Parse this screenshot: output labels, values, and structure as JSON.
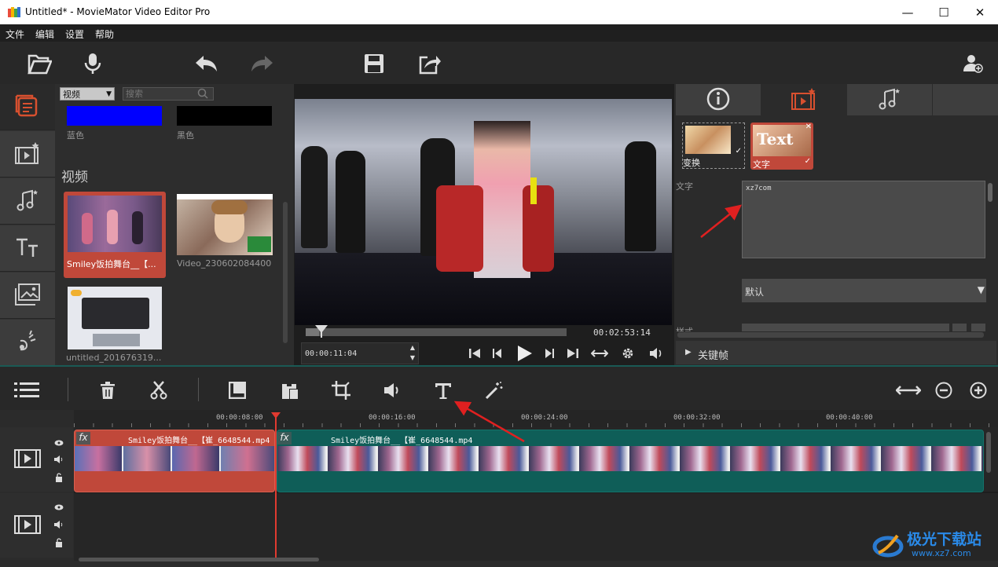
{
  "window": {
    "title": "Untitled* - MovieMator Video Editor Pro",
    "minimize": "—",
    "maximize": "☐",
    "close": "✕"
  },
  "menu": [
    "文件",
    "编辑",
    "设置",
    "帮助"
  ],
  "toolbar": {
    "icons": [
      "open-icon",
      "microphone-icon",
      "undo-icon",
      "redo-icon",
      "save-icon",
      "export-icon",
      "account-icon"
    ]
  },
  "left_tabs": [
    "media-icon",
    "filters-icon",
    "audio-icon",
    "text-icon",
    "pictures-icon",
    "effects-icon"
  ],
  "media": {
    "filter_select": "视频",
    "search_placeholder": "搜索",
    "colors": [
      {
        "label": "蓝色",
        "color": "#0000ff"
      },
      {
        "label": "黑色",
        "color": "#000000"
      }
    ],
    "section": "视频",
    "items": [
      {
        "label": "Smiley饭拍舞台__【..."
      },
      {
        "label": "Video_230602084400"
      },
      {
        "label": "untitled_201676319..."
      }
    ]
  },
  "preview": {
    "total_time": "00:02:53:14",
    "current_time": "00:00:11:04",
    "playhead_progress": 0.05
  },
  "props": {
    "tabs": [
      "info-icon",
      "filters-icon",
      "audio-icon"
    ],
    "filters": [
      {
        "label": "变换"
      },
      {
        "label": "文字",
        "thumb_text": "Text"
      }
    ],
    "text_label": "文字",
    "text_value": "xz7com",
    "font_select": "默认",
    "style_label": "样式",
    "keyframes": "关键帧"
  },
  "timeline": {
    "ruler": [
      "00:00:08:00",
      "00:00:16:00",
      "00:00:24:00",
      "00:00:32:00",
      "00:00:40:00"
    ],
    "clip1": "Smiley饭拍舞台__【崔_6648544.mp4",
    "clip2": "Smiley饭拍舞台__【崔_6648544.mp4",
    "fx": "fx"
  },
  "watermark": {
    "text": "极光下载站",
    "url": "www.xz7.com"
  },
  "colors": {
    "accent": "#c0483a",
    "clip2": "#0f5e58",
    "playhead": "#e03a30",
    "annotation": "#e02020"
  }
}
